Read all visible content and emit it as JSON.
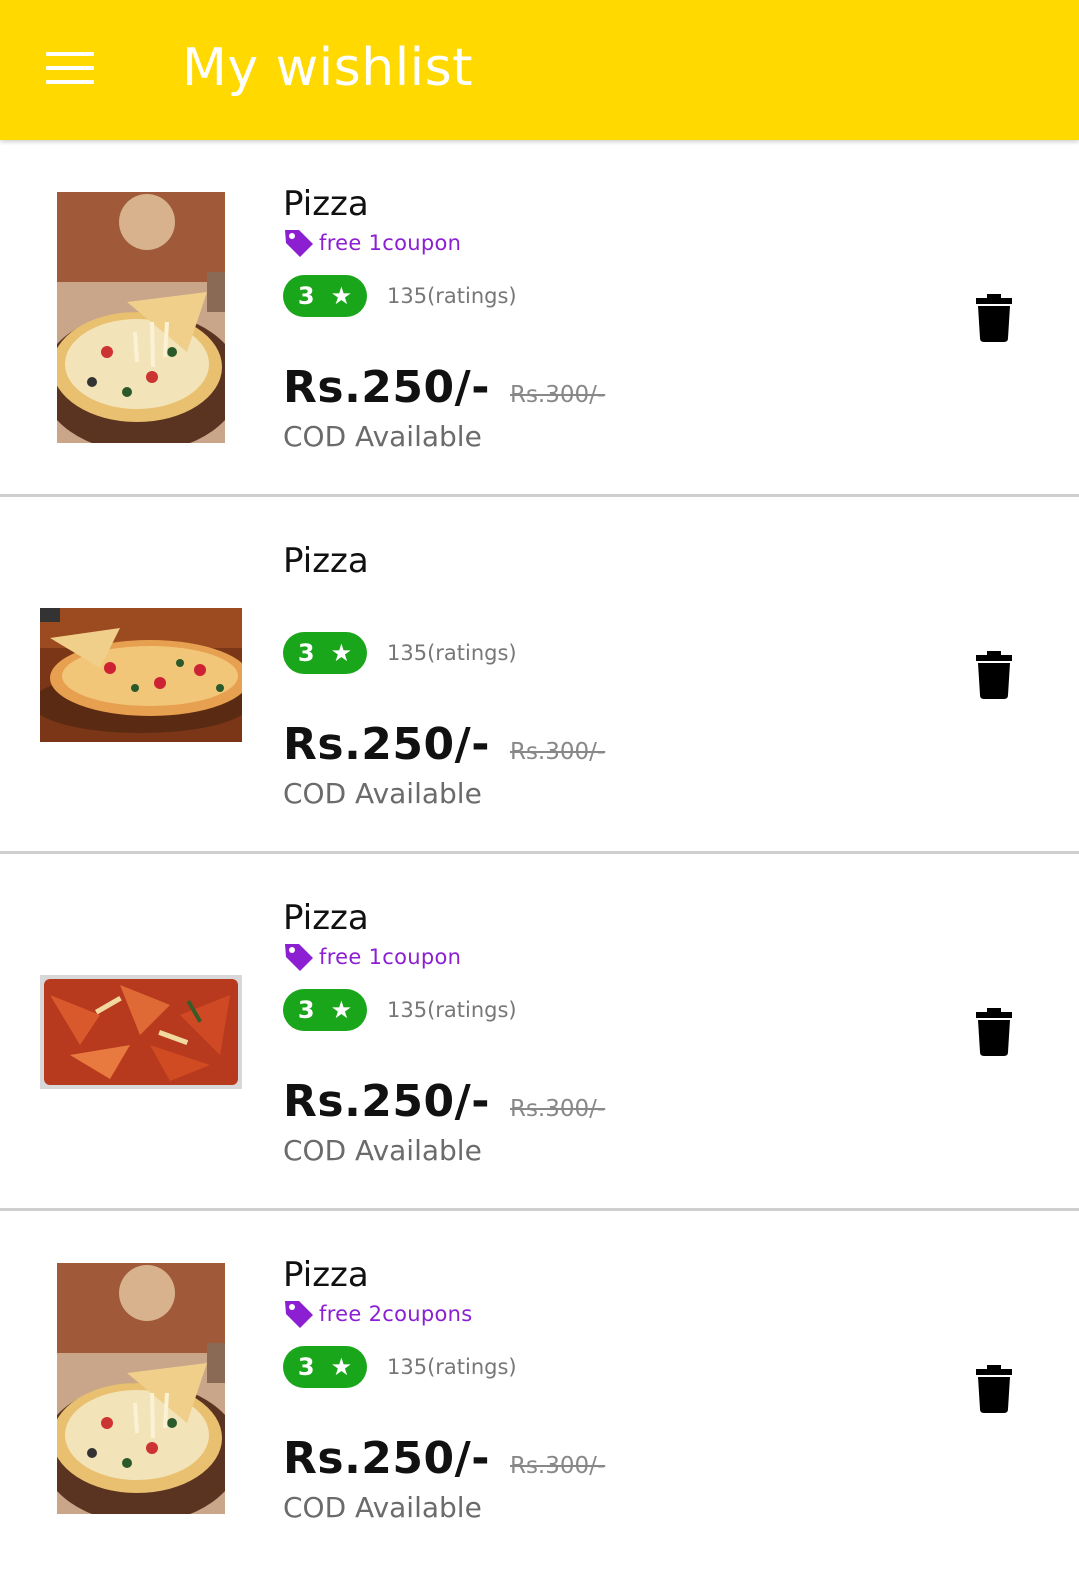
{
  "appbar": {
    "title": "My wishlist",
    "background": "#FFD900"
  },
  "items": [
    {
      "name": "Pizza",
      "coupon": "free 1coupon",
      "rating": "3",
      "rating_star": "★",
      "ratings_count": "135(ratings)",
      "price": "Rs.250/-",
      "old_price": "Rs.300/-",
      "cod": "COD Available"
    },
    {
      "name": "Pizza",
      "coupon": "",
      "rating": "3",
      "rating_star": "★",
      "ratings_count": "135(ratings)",
      "price": "Rs.250/-",
      "old_price": "Rs.300/-",
      "cod": "COD Available"
    },
    {
      "name": "Pizza",
      "coupon": "free 1coupon",
      "rating": "3",
      "rating_star": "★",
      "ratings_count": "135(ratings)",
      "price": "Rs.250/-",
      "old_price": "Rs.300/-",
      "cod": "COD Available"
    },
    {
      "name": "Pizza",
      "coupon": "free 2coupons",
      "rating": "3",
      "rating_star": "★",
      "ratings_count": "135(ratings)",
      "price": "Rs.250/-",
      "old_price": "Rs.300/-",
      "cod": "COD Available"
    }
  ],
  "colors": {
    "rating_badge": "#1AA61A",
    "coupon": "#8B1FD1"
  }
}
